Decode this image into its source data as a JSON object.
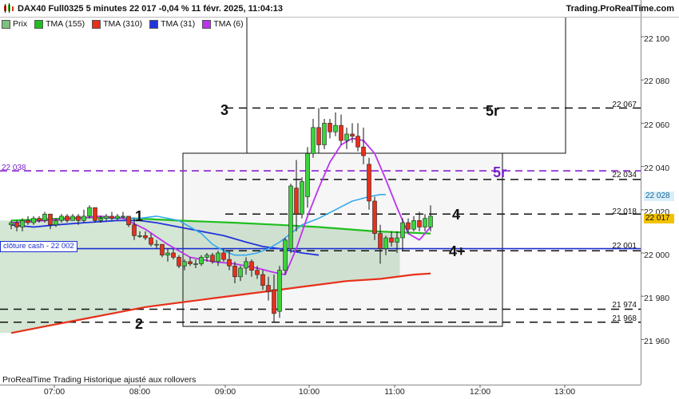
{
  "header": {
    "title": "DAX40 Full0325 5 minutes 22 017 -0,04 % 11 févr. 2025, 11:04:13",
    "site": "Trading.ProRealTime.com"
  },
  "legend": [
    {
      "label": "Prix",
      "color": "#7fbf7f"
    },
    {
      "label": "TMA (155)",
      "color": "#1fbf1f"
    },
    {
      "label": "TMA (310)",
      "color": "#e8301a"
    },
    {
      "label": "TMA (31)",
      "color": "#2233dd"
    },
    {
      "label": "TMA (6)",
      "color": "#bb33ee"
    }
  ],
  "footer": "ProRealTime Trading  Historique ajusté aux rollovers",
  "cash_label": "clôture cash -  22 002",
  "cut_label": "22 038",
  "colors": {
    "up": "#3cd23c",
    "down": "#e8301a",
    "wick": "#111111",
    "tma155": "#1fbf1f",
    "tma310": "#e8301a",
    "tma31": "#2233dd",
    "tma6": "#bb33ee",
    "tma_fast_cyan": "#33aaee",
    "cash_line": "#1a2fd0",
    "cut_line": "#8a22cc",
    "green_fill": "#cfe3cf"
  },
  "markers": [
    {
      "text": "1",
      "style": "plain"
    },
    {
      "text": "2",
      "style": "plain"
    },
    {
      "text": "3",
      "style": "plain"
    },
    {
      "text": "4",
      "style": "plain"
    },
    {
      "text": "4+",
      "style": "plain"
    },
    {
      "text": "5r",
      "style": "plain"
    },
    {
      "text": "5r",
      "style": "purple"
    }
  ],
  "chart_data": {
    "type": "candlestick",
    "ylim": [
      21940,
      22115
    ],
    "yticks": [
      "21 960",
      "21 980",
      "22 000",
      "22 020",
      "22 040",
      "22 060",
      "22 080",
      "22 100"
    ],
    "xticks": [
      "07:00",
      "08:00",
      "09:00",
      "10:00",
      "11:00",
      "12:00",
      "13:00"
    ],
    "candles": [
      {
        "o": 22013,
        "h": 22015,
        "l": 22011,
        "c": 22014
      },
      {
        "o": 22014,
        "h": 22015,
        "l": 22010,
        "c": 22012
      },
      {
        "o": 22012,
        "h": 22016,
        "l": 22010,
        "c": 22015
      },
      {
        "o": 22015,
        "h": 22017,
        "l": 22013,
        "c": 22014
      },
      {
        "o": 22014,
        "h": 22017,
        "l": 22013,
        "c": 22016
      },
      {
        "o": 22016,
        "h": 22017,
        "l": 22014,
        "c": 22015
      },
      {
        "o": 22015,
        "h": 22019,
        "l": 22014,
        "c": 22018
      },
      {
        "o": 22018,
        "h": 22018,
        "l": 22011,
        "c": 22013
      },
      {
        "o": 22013,
        "h": 22016,
        "l": 22012,
        "c": 22015
      },
      {
        "o": 22015,
        "h": 22018,
        "l": 22014,
        "c": 22017
      },
      {
        "o": 22017,
        "h": 22018,
        "l": 22014,
        "c": 22015
      },
      {
        "o": 22015,
        "h": 22018,
        "l": 22015,
        "c": 22017
      },
      {
        "o": 22017,
        "h": 22018,
        "l": 22013,
        "c": 22015
      },
      {
        "o": 22015,
        "h": 22020,
        "l": 22014,
        "c": 22017
      },
      {
        "o": 22017,
        "h": 22022,
        "l": 22016,
        "c": 22021
      },
      {
        "o": 22021,
        "h": 22021,
        "l": 22014,
        "c": 22015
      },
      {
        "o": 22015,
        "h": 22017,
        "l": 22014,
        "c": 22016
      },
      {
        "o": 22016,
        "h": 22018,
        "l": 22015,
        "c": 22017
      },
      {
        "o": 22017,
        "h": 22019,
        "l": 22015,
        "c": 22016
      },
      {
        "o": 22016,
        "h": 22018,
        "l": 22015,
        "c": 22017
      },
      {
        "o": 22017,
        "h": 22019,
        "l": 22016,
        "c": 22017
      },
      {
        "o": 22017,
        "h": 22017,
        "l": 22012,
        "c": 22013
      },
      {
        "o": 22013,
        "h": 22016,
        "l": 22006,
        "c": 22008
      },
      {
        "o": 22008,
        "h": 22010,
        "l": 22007,
        "c": 22008
      },
      {
        "o": 22008,
        "h": 22010,
        "l": 22006,
        "c": 22007
      },
      {
        "o": 22007,
        "h": 22009,
        "l": 22003,
        "c": 22004
      },
      {
        "o": 22004,
        "h": 22006,
        "l": 22002,
        "c": 22004
      },
      {
        "o": 22004,
        "h": 22004,
        "l": 21998,
        "c": 21999
      },
      {
        "o": 21999,
        "h": 22002,
        "l": 21996,
        "c": 22000
      },
      {
        "o": 22000,
        "h": 22002,
        "l": 21997,
        "c": 21998
      },
      {
        "o": 21998,
        "h": 21999,
        "l": 21993,
        "c": 21994
      },
      {
        "o": 21994,
        "h": 21997,
        "l": 21992,
        "c": 21996
      },
      {
        "o": 21996,
        "h": 21998,
        "l": 21994,
        "c": 21995
      },
      {
        "o": 21995,
        "h": 21997,
        "l": 21993,
        "c": 21995
      },
      {
        "o": 21995,
        "h": 21999,
        "l": 21994,
        "c": 21998
      },
      {
        "o": 21998,
        "h": 22000,
        "l": 21996,
        "c": 21999
      },
      {
        "o": 21999,
        "h": 22000,
        "l": 21995,
        "c": 21996
      },
      {
        "o": 21996,
        "h": 22001,
        "l": 21994,
        "c": 22000
      },
      {
        "o": 22000,
        "h": 22002,
        "l": 21996,
        "c": 21997
      },
      {
        "o": 21997,
        "h": 22001,
        "l": 21992,
        "c": 21994
      },
      {
        "o": 21994,
        "h": 21996,
        "l": 21986,
        "c": 21989
      },
      {
        "o": 21989,
        "h": 21994,
        "l": 21987,
        "c": 21993
      },
      {
        "o": 21993,
        "h": 21998,
        "l": 21990,
        "c": 21996
      },
      {
        "o": 21996,
        "h": 21997,
        "l": 21989,
        "c": 21992
      },
      {
        "o": 21992,
        "h": 21994,
        "l": 21988,
        "c": 21990
      },
      {
        "o": 21990,
        "h": 21992,
        "l": 21983,
        "c": 21985
      },
      {
        "o": 21985,
        "h": 21989,
        "l": 21978,
        "c": 21982
      },
      {
        "o": 21983,
        "h": 21990,
        "l": 21968,
        "c": 21972
      },
      {
        "o": 21973,
        "h": 21994,
        "l": 21970,
        "c": 21992
      },
      {
        "o": 21992,
        "h": 22007,
        "l": 21990,
        "c": 22006
      },
      {
        "o": 22002,
        "h": 22032,
        "l": 22000,
        "c": 22031
      },
      {
        "o": 22030,
        "h": 22043,
        "l": 22010,
        "c": 22018
      },
      {
        "o": 22018,
        "h": 22035,
        "l": 22016,
        "c": 22033
      },
      {
        "o": 22026,
        "h": 22049,
        "l": 22021,
        "c": 22046
      },
      {
        "o": 22046,
        "h": 22062,
        "l": 22044,
        "c": 22058
      },
      {
        "o": 22058,
        "h": 22067,
        "l": 22046,
        "c": 22050
      },
      {
        "o": 22050,
        "h": 22062,
        "l": 22048,
        "c": 22060
      },
      {
        "o": 22060,
        "h": 22062,
        "l": 22053,
        "c": 22056
      },
      {
        "o": 22056,
        "h": 22065,
        "l": 22054,
        "c": 22059
      },
      {
        "o": 22059,
        "h": 22064,
        "l": 22050,
        "c": 22052
      },
      {
        "o": 22052,
        "h": 22058,
        "l": 22048,
        "c": 22055
      },
      {
        "o": 22055,
        "h": 22060,
        "l": 22051,
        "c": 22054
      },
      {
        "o": 22054,
        "h": 22060,
        "l": 22047,
        "c": 22049
      },
      {
        "o": 22049,
        "h": 22058,
        "l": 22041,
        "c": 22045
      },
      {
        "o": 22041,
        "h": 22044,
        "l": 22020,
        "c": 22024
      },
      {
        "o": 22024,
        "h": 22026,
        "l": 22006,
        "c": 22009
      },
      {
        "o": 22009,
        "h": 22013,
        "l": 21995,
        "c": 22002
      },
      {
        "o": 22002,
        "h": 22008,
        "l": 21999,
        "c": 22007
      },
      {
        "o": 22007,
        "h": 22010,
        "l": 22003,
        "c": 22005
      },
      {
        "o": 22005,
        "h": 22010,
        "l": 22000,
        "c": 22007
      },
      {
        "o": 22007,
        "h": 22016,
        "l": 22001,
        "c": 22014
      },
      {
        "o": 22014,
        "h": 22016,
        "l": 22009,
        "c": 22011
      },
      {
        "o": 22011,
        "h": 22017,
        "l": 22010,
        "c": 22015
      },
      {
        "o": 22015,
        "h": 22019,
        "l": 22010,
        "c": 22012
      },
      {
        "o": 22012,
        "h": 22018,
        "l": 22010,
        "c": 22016
      },
      {
        "o": 22012,
        "h": 22022,
        "l": 22010,
        "c": 22017
      }
    ],
    "tma155": [
      [
        0,
        22015
      ],
      [
        10,
        22016
      ],
      [
        15,
        22016.5
      ],
      [
        22,
        22016
      ],
      [
        30,
        22015
      ],
      [
        40,
        22014
      ],
      [
        48,
        22013
      ],
      [
        55,
        22012
      ],
      [
        65,
        22010
      ],
      [
        75,
        22009
      ]
    ],
    "tma310": [
      [
        0,
        21963
      ],
      [
        6,
        21966
      ],
      [
        12,
        21969
      ],
      [
        18,
        21972
      ],
      [
        24,
        21975
      ],
      [
        30,
        21977
      ],
      [
        36,
        21979
      ],
      [
        42,
        21981
      ],
      [
        48,
        21983
      ],
      [
        54,
        21985
      ],
      [
        60,
        21987
      ],
      [
        66,
        21988
      ],
      [
        72,
        21990
      ],
      [
        75,
        21990.5
      ]
    ],
    "tma31": [
      [
        0,
        22013
      ],
      [
        4,
        22012
      ],
      [
        8,
        22013
      ],
      [
        13,
        22014
      ],
      [
        19,
        22015
      ],
      [
        23,
        22015
      ],
      [
        26,
        22014
      ],
      [
        30,
        22012
      ],
      [
        34,
        22010
      ],
      [
        38,
        22008
      ],
      [
        42,
        22005
      ],
      [
        45,
        22003
      ],
      [
        48,
        22002
      ],
      [
        52,
        22000
      ],
      [
        55,
        21999
      ]
    ],
    "tma6": [
      [
        0,
        22014
      ],
      [
        6,
        22015
      ],
      [
        12,
        22016
      ],
      [
        16,
        22017
      ],
      [
        20,
        22016
      ],
      [
        24,
        22011
      ],
      [
        28,
        22004
      ],
      [
        32,
        21998
      ],
      [
        36,
        21996
      ],
      [
        40,
        21995
      ],
      [
        44,
        21993
      ],
      [
        47,
        21991
      ],
      [
        49,
        21990
      ],
      [
        51,
        22002
      ],
      [
        53,
        22017
      ],
      [
        55,
        22030
      ],
      [
        57,
        22042
      ],
      [
        59,
        22050
      ],
      [
        61,
        22053
      ],
      [
        63,
        22052
      ],
      [
        65,
        22046
      ],
      [
        67,
        22034
      ],
      [
        69,
        22021
      ],
      [
        71,
        22009
      ],
      [
        73,
        22006
      ],
      [
        75,
        22012
      ]
    ],
    "tma_fast_cyan": [
      [
        17,
        22016
      ],
      [
        20,
        22016
      ],
      [
        23,
        22016
      ],
      [
        26,
        22017
      ],
      [
        28,
        22016
      ],
      [
        30,
        22015
      ],
      [
        32,
        22012
      ],
      [
        34,
        22009
      ],
      [
        36,
        22004
      ],
      [
        38,
        22001
      ],
      [
        40,
        21999
      ],
      [
        42,
        21999
      ],
      [
        44,
        22000
      ],
      [
        46,
        22002
      ],
      [
        48,
        22005
      ],
      [
        50,
        22009
      ],
      [
        52,
        22013
      ],
      [
        55,
        22016
      ],
      [
        58,
        22020
      ],
      [
        61,
        22024
      ],
      [
        64,
        22026
      ],
      [
        66,
        22027
      ],
      [
        67,
        22027
      ]
    ],
    "horizontal_levels": [
      {
        "label": "22 067",
        "value": 22067,
        "style": "dashed"
      },
      {
        "label": "22 034",
        "value": 22034,
        "style": "dashed"
      },
      {
        "label": "22 018",
        "value": 22018,
        "style": "dashed"
      },
      {
        "label": "22 001",
        "value": 22001,
        "style": "dashed"
      },
      {
        "label": "21 974",
        "value": 21974,
        "style": "dashed"
      },
      {
        "label": "21 968",
        "value": 21968,
        "style": "dashed"
      }
    ],
    "purple_level": {
      "label": "22 038",
      "value": 22038
    },
    "cash_close": {
      "value": 22002
    },
    "last_values": [
      {
        "label": "22 028",
        "value": 22028,
        "color": "#33aaee"
      },
      {
        "label": "22 017",
        "value": 22017,
        "color": "#f2c200"
      }
    ]
  }
}
